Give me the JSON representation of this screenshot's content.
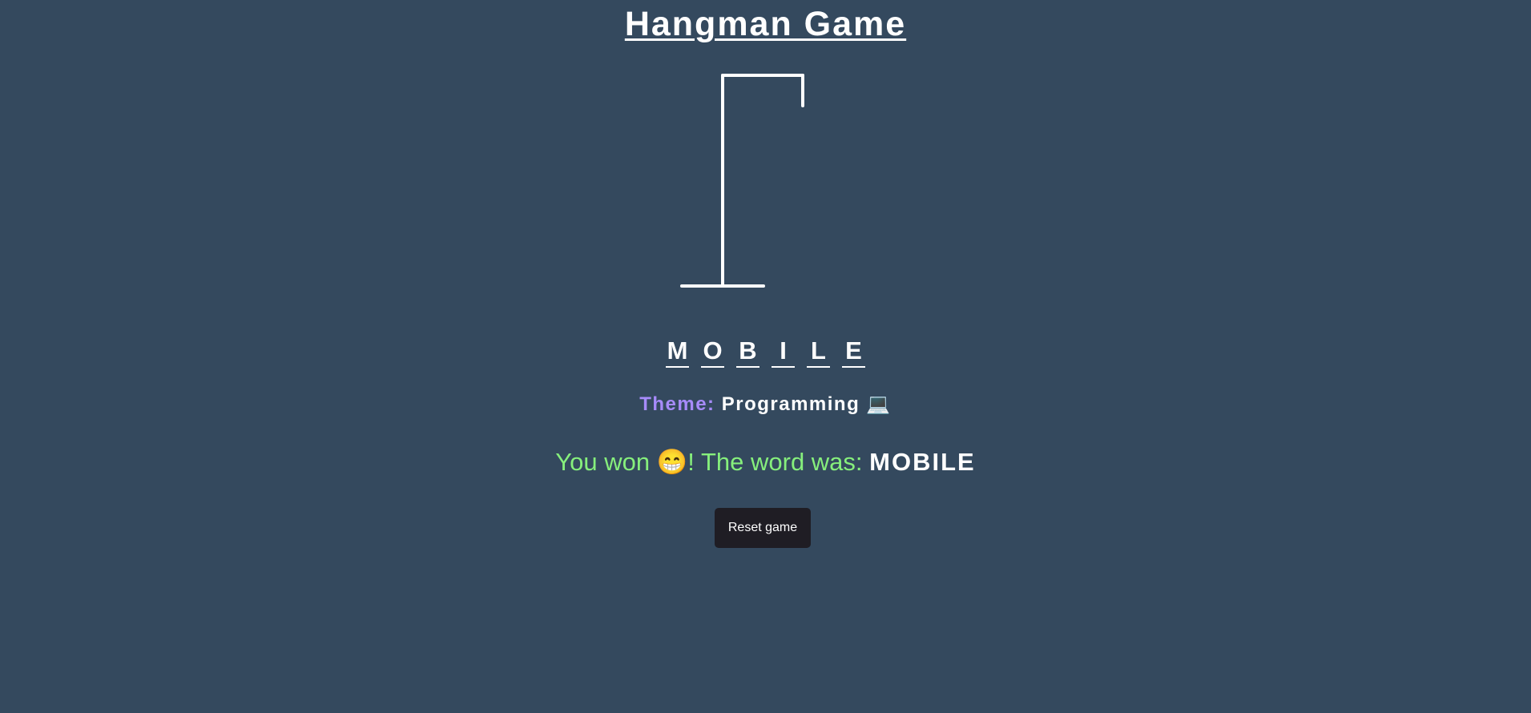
{
  "title": "Hangman Game",
  "word": {
    "letters": [
      "M",
      "O",
      "B",
      "I",
      "L",
      "E"
    ]
  },
  "theme": {
    "label": "Theme:",
    "value": "Programming",
    "emoji": "💻"
  },
  "result": {
    "prefix": "You won",
    "emoji": "😁",
    "middle": "! The word was:",
    "word": "MOBILE"
  },
  "reset_button": {
    "label": "Reset game"
  },
  "colors": {
    "background": "#34495e",
    "theme_label": "#a78bfa",
    "win_text": "#86ef7c",
    "button_bg": "#1f1d24"
  }
}
